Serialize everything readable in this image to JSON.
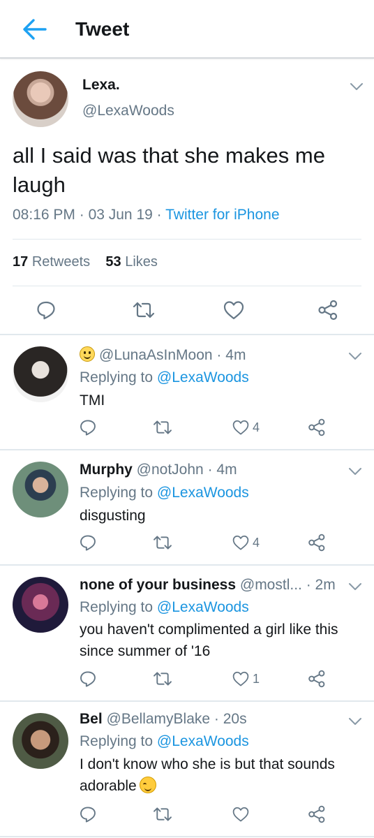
{
  "header": {
    "title": "Tweet"
  },
  "main_tweet": {
    "name": "Lexa.",
    "handle": "@LexaWoods",
    "text": "all I said was that she makes me laugh",
    "time": "08:16 PM",
    "date": "03 Jun 19",
    "source": "Twitter for iPhone",
    "retweets_count": "17",
    "retweets_label": "Retweets",
    "likes_count": "53",
    "likes_label": "Likes"
  },
  "replies": [
    {
      "name": "",
      "handle": "@LunaAsInMoon",
      "age": "4m",
      "replying_prefix": "Replying to",
      "replying_to": "@LexaWoods",
      "text": "TMI",
      "like_count": "4",
      "emoji_prefix": "smiley-emoji"
    },
    {
      "name": "Murphy",
      "handle": "@notJohn",
      "age": "4m",
      "replying_prefix": "Replying to",
      "replying_to": "@LexaWoods",
      "text": "disgusting",
      "like_count": "4"
    },
    {
      "name": "none of your business",
      "handle": "@mostl...",
      "age": "2m",
      "replying_prefix": "Replying to",
      "replying_to": "@LexaWoods",
      "text": "you haven't complimented a girl like this since summer of '16",
      "like_count": "1"
    },
    {
      "name": "Bel",
      "handle": "@BellamyBlake",
      "age": "20s",
      "replying_prefix": "Replying to",
      "replying_to": "@LexaWoods",
      "text": "I don't know who she is but that sounds adorable",
      "like_count": "",
      "emoji_suffix": "blush-emoji"
    }
  ],
  "colors": {
    "accent": "#1da1f2",
    "link": "#1b95e0",
    "muted": "#657786",
    "text": "#14171a",
    "divider": "#e1e8ed"
  },
  "icons": [
    "arrow-left-icon",
    "chevron-down-icon",
    "reply-icon",
    "retweet-icon",
    "like-icon",
    "share-icon"
  ]
}
